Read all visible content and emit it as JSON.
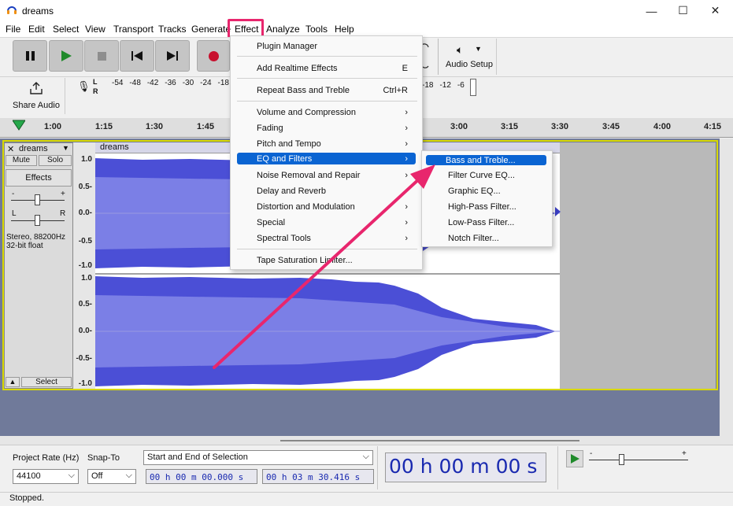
{
  "window": {
    "title": "dreams",
    "min": "—",
    "max": "☐",
    "close": "✕"
  },
  "menu": {
    "items": [
      "File",
      "Edit",
      "Select",
      "View",
      "Transport",
      "Tracks",
      "Generate",
      "Effect",
      "Analyze",
      "Tools",
      "Help"
    ]
  },
  "toolbar": {
    "share_audio": "Share Audio",
    "audio_setup": "Audio Setup",
    "meter_ticks": [
      "-54",
      "-48",
      "-42",
      "-36",
      "-30",
      "-24",
      "-18"
    ],
    "meter_ticks_right": [
      "-18",
      "-12",
      "-6"
    ],
    "lr_top": "L",
    "lr_bottom": "R"
  },
  "ruler": {
    "ticks": [
      "1:00",
      "1:15",
      "1:30",
      "1:45",
      "3:00",
      "3:15",
      "3:30",
      "3:45",
      "4:00",
      "4:15"
    ]
  },
  "track": {
    "name": "dreams",
    "clip_name": "dreams",
    "mute": "Mute",
    "solo": "Solo",
    "effects": "Effects",
    "gain_minus": "-",
    "gain_plus": "+",
    "pan_l": "L",
    "pan_r": "R",
    "info_line1": "Stereo, 88200Hz",
    "info_line2": "32-bit float",
    "select": "Select",
    "collapse": "▲",
    "close": "✕",
    "menu": "▼",
    "y_labels": [
      "1.0",
      "0.5-",
      "0.0-",
      "-0.5",
      "-1.0",
      "1.0",
      "0.5-",
      "0.0-",
      "-0.5-",
      "-1.0"
    ]
  },
  "effect_menu": {
    "items": [
      {
        "label": "Plugin Manager",
        "shortcut": ""
      },
      {
        "label": "Add Realtime Effects",
        "shortcut": "E"
      },
      {
        "label": "Repeat Bass and Treble",
        "shortcut": "Ctrl+R"
      },
      {
        "label": "Volume and Compression",
        "shortcut": "›"
      },
      {
        "label": "Fading",
        "shortcut": "›"
      },
      {
        "label": "Pitch and Tempo",
        "shortcut": "›"
      },
      {
        "label": "EQ and Filters",
        "shortcut": "›"
      },
      {
        "label": "Noise Removal and Repair",
        "shortcut": "›"
      },
      {
        "label": "Delay and Reverb",
        "shortcut": ""
      },
      {
        "label": "Distortion and Modulation",
        "shortcut": "›"
      },
      {
        "label": "Special",
        "shortcut": "›"
      },
      {
        "label": "Spectral Tools",
        "shortcut": "›"
      },
      {
        "label": "Tape Saturation Limiter...",
        "shortcut": ""
      }
    ]
  },
  "eq_submenu": {
    "items": [
      "Bass and Treble...",
      "Filter Curve EQ...",
      "Graphic EQ...",
      "High-Pass Filter...",
      "Low-Pass Filter...",
      "Notch Filter..."
    ]
  },
  "bottom": {
    "project_rate_label": "Project Rate (Hz)",
    "snap_to_label": "Snap-To",
    "selection_mode": "Start and End of Selection",
    "rate_value": "44100",
    "snap_value": "Off",
    "sel_start": "00 h 00 m 00.000 s",
    "sel_end": "00 h 03 m 30.416 s",
    "big_time": "00 h 00 m 00 s",
    "minus": "-",
    "plus": "+"
  },
  "status": {
    "text": "Stopped."
  },
  "colors": {
    "accent": "#e8266d",
    "selection": "#0a64d2",
    "waveform": "#4b4fd6"
  }
}
